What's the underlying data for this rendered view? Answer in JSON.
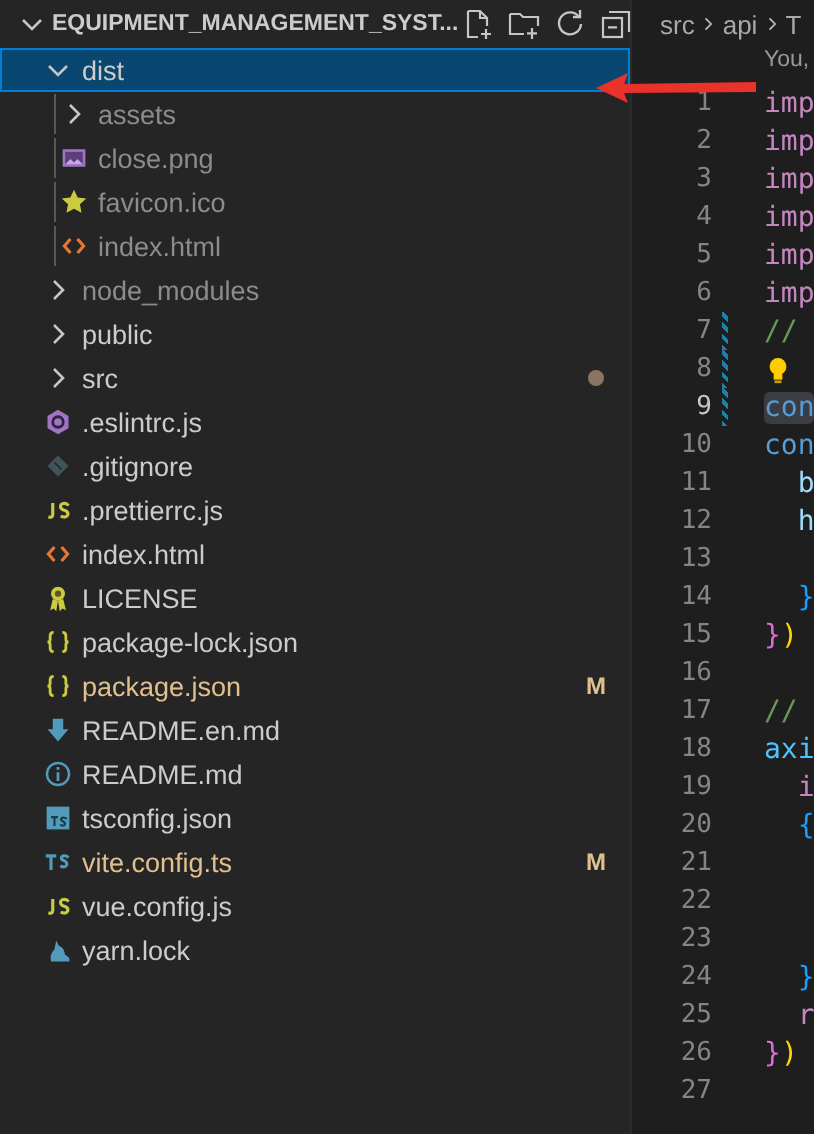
{
  "explorer": {
    "title": "EQUIPMENT_MANAGEMENT_SYST...",
    "expanded": true,
    "actions": [
      {
        "kind": "new-file"
      },
      {
        "kind": "new-folder"
      },
      {
        "kind": "refresh"
      },
      {
        "kind": "collapse"
      }
    ],
    "tree": [
      {
        "name": "dist",
        "kind": "folder",
        "expanded": true,
        "selected": true,
        "ignored": false,
        "children": [
          {
            "name": "assets",
            "kind": "folder",
            "expanded": false,
            "selected": false,
            "ignored": true
          },
          {
            "name": "close.png",
            "kind": "image",
            "selected": false,
            "ignored": true
          },
          {
            "name": "favicon.ico",
            "kind": "star",
            "selected": false,
            "ignored": true
          },
          {
            "name": "index.html",
            "kind": "html",
            "selected": false,
            "ignored": true
          }
        ]
      },
      {
        "name": "node_modules",
        "kind": "folder",
        "expanded": false,
        "selected": false,
        "ignored": true
      },
      {
        "name": "public",
        "kind": "folder",
        "expanded": false,
        "selected": false,
        "ignored": false
      },
      {
        "name": "src",
        "kind": "folder",
        "expanded": false,
        "selected": false,
        "ignored": false,
        "modified_dot": true
      },
      {
        "name": ".eslintrc.js",
        "kind": "eslint",
        "selected": false,
        "ignored": false
      },
      {
        "name": ".gitignore",
        "kind": "git",
        "selected": false,
        "ignored": false
      },
      {
        "name": ".prettierrc.js",
        "kind": "js",
        "selected": false,
        "ignored": false
      },
      {
        "name": "index.html",
        "kind": "html",
        "selected": false,
        "ignored": false
      },
      {
        "name": "LICENSE",
        "kind": "license",
        "selected": false,
        "ignored": false
      },
      {
        "name": "package-lock.json",
        "kind": "json",
        "selected": false,
        "ignored": false
      },
      {
        "name": "package.json",
        "kind": "json",
        "selected": false,
        "ignored": false,
        "modified": true,
        "badge": "M"
      },
      {
        "name": "README.en.md",
        "kind": "download",
        "selected": false,
        "ignored": false
      },
      {
        "name": "README.md",
        "kind": "info",
        "selected": false,
        "ignored": false
      },
      {
        "name": "tsconfig.json",
        "kind": "tsbox",
        "selected": false,
        "ignored": false
      },
      {
        "name": "vite.config.ts",
        "kind": "ts",
        "selected": false,
        "ignored": false,
        "modified": true,
        "badge": "M"
      },
      {
        "name": "vue.config.js",
        "kind": "js",
        "selected": false,
        "ignored": false
      },
      {
        "name": "yarn.lock",
        "kind": "yarn",
        "selected": false,
        "ignored": false
      }
    ]
  },
  "editor": {
    "breadcrumb": [
      "src",
      "api",
      "T"
    ],
    "codelens": "You,",
    "lines": [
      {
        "number": "1",
        "tokens": [
          {
            "text": "imp",
            "kind": "keyword"
          }
        ]
      },
      {
        "number": "2",
        "tokens": [
          {
            "text": "imp",
            "kind": "keyword"
          }
        ]
      },
      {
        "number": "3",
        "tokens": [
          {
            "text": "imp",
            "kind": "keyword"
          }
        ]
      },
      {
        "number": "4",
        "tokens": [
          {
            "text": "imp",
            "kind": "keyword"
          }
        ]
      },
      {
        "number": "5",
        "tokens": [
          {
            "text": "imp",
            "kind": "keyword"
          }
        ]
      },
      {
        "number": "6",
        "tokens": [
          {
            "text": "imp",
            "kind": "keyword"
          }
        ]
      },
      {
        "number": "7",
        "changed": true,
        "tokens": [
          {
            "text": "//",
            "kind": "comment"
          }
        ]
      },
      {
        "number": "8",
        "changed": true,
        "lightbulb": true
      },
      {
        "number": "9",
        "changed": true,
        "current": true,
        "tokens": [
          {
            "text": "con",
            "kind": "storage"
          }
        ]
      },
      {
        "number": "10",
        "tokens": [
          {
            "text": "con",
            "kind": "storage"
          }
        ]
      },
      {
        "number": "11",
        "tokens": [
          {
            "text": "  b",
            "kind": "variable"
          }
        ]
      },
      {
        "number": "12",
        "tokens": [
          {
            "text": "  h",
            "kind": "variable"
          }
        ]
      },
      {
        "number": "13"
      },
      {
        "number": "14",
        "tokens": [
          {
            "text": "  }",
            "kind": "bracket-blue"
          }
        ]
      },
      {
        "number": "15",
        "tokens": [
          {
            "text": "}",
            "kind": "bracket-pink"
          },
          {
            "text": ")",
            "kind": "bracket-gold"
          }
        ]
      },
      {
        "number": "16"
      },
      {
        "number": "17",
        "tokens": [
          {
            "text": "//",
            "kind": "comment"
          }
        ]
      },
      {
        "number": "18",
        "tokens": [
          {
            "text": "axi",
            "kind": "constant"
          }
        ]
      },
      {
        "number": "19",
        "tokens": [
          {
            "text": "  i",
            "kind": "keyword"
          }
        ]
      },
      {
        "number": "20",
        "tokens": [
          {
            "text": "  {",
            "kind": "bracket-blue"
          }
        ]
      },
      {
        "number": "21"
      },
      {
        "number": "22"
      },
      {
        "number": "23"
      },
      {
        "number": "24",
        "tokens": [
          {
            "text": "  }",
            "kind": "bracket-blue"
          }
        ]
      },
      {
        "number": "25",
        "tokens": [
          {
            "text": "  r",
            "kind": "keyword"
          }
        ]
      },
      {
        "number": "26",
        "tokens": [
          {
            "text": "}",
            "kind": "bracket-pink"
          },
          {
            "text": ")",
            "kind": "bracket-gold"
          }
        ]
      },
      {
        "number": "27"
      }
    ]
  },
  "annotation": {
    "kind": "arrow"
  }
}
